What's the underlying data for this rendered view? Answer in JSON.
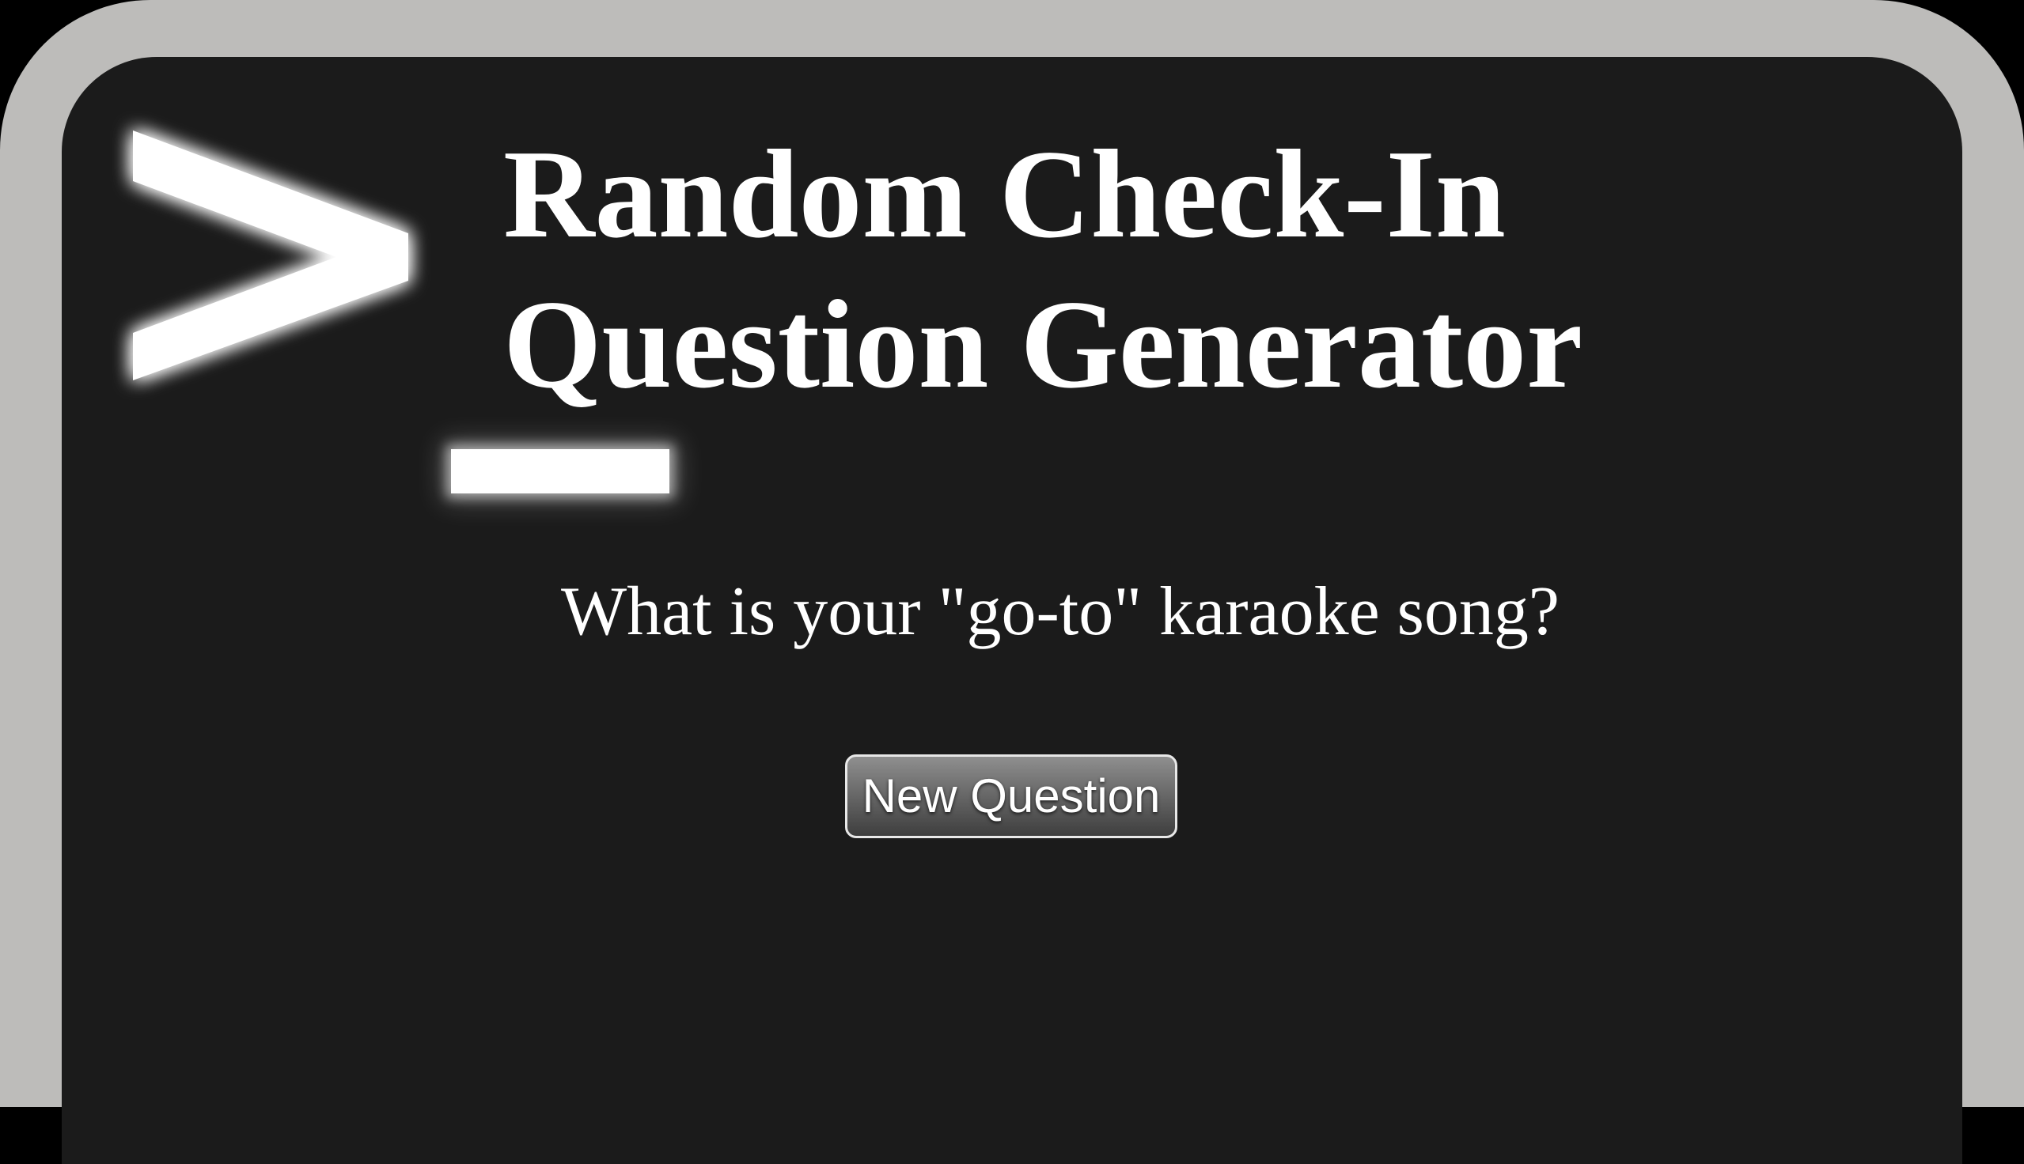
{
  "app": {
    "title": "Random Check-In Question Generator",
    "logo_icon": "terminal-prompt-icon"
  },
  "main": {
    "question_text": "What is your \"go-to\" karaoke song?",
    "new_question_label": "New Question"
  },
  "colors": {
    "frame": "#bdbcba",
    "screen": "#1b1b1b",
    "text": "#ffffff",
    "outer_background": "#000000"
  }
}
